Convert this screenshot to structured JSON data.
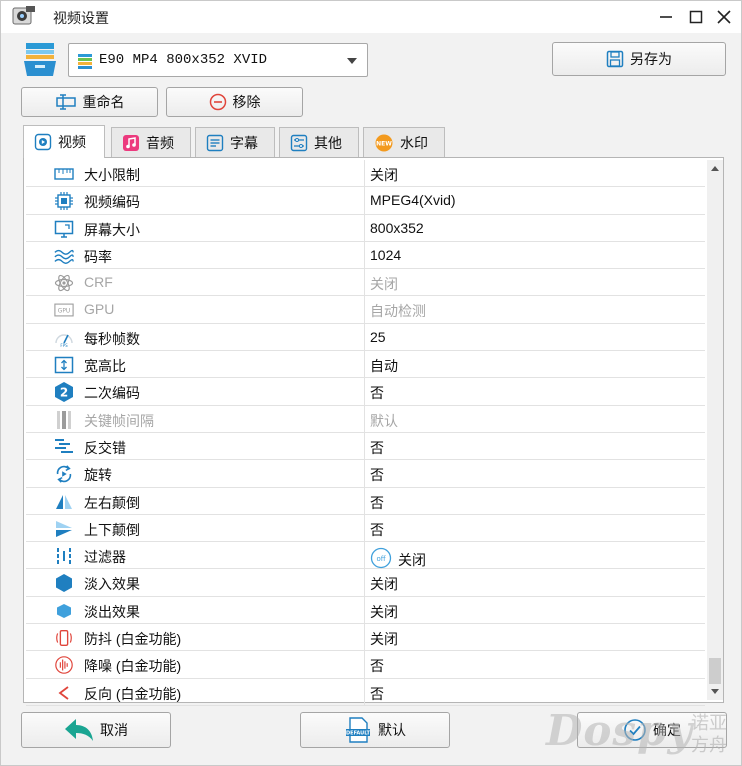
{
  "window": {
    "title": "视频设置"
  },
  "profile": {
    "selected": "E90 MP4 800x352 XVID"
  },
  "buttons": {
    "save_as": "另存为",
    "rename": "重命名",
    "remove": "移除",
    "cancel": "取消",
    "default": "默认",
    "ok": "确定"
  },
  "tabs": [
    {
      "label": "视频",
      "icon": "video-tab-icon"
    },
    {
      "label": "音频",
      "icon": "music-note-icon"
    },
    {
      "label": "字幕",
      "icon": "subtitle-icon"
    },
    {
      "label": "其他",
      "icon": "sliders-icon"
    },
    {
      "label": "水印",
      "icon": "new-badge-icon"
    }
  ],
  "properties": [
    {
      "name": "大小限制",
      "value": "关闭",
      "icon": "ruler-icon"
    },
    {
      "name": "视频编码",
      "value": "MPEG4(Xvid)",
      "icon": "chip-icon"
    },
    {
      "name": "屏幕大小",
      "value": "800x352",
      "icon": "monitor-icon"
    },
    {
      "name": "码率",
      "value": "1024",
      "icon": "wave-icon"
    },
    {
      "name": "CRF",
      "value": "关闭",
      "icon": "atom-icon",
      "disabled": true
    },
    {
      "name": "GPU",
      "value": "自动检测",
      "icon": "gpu-icon",
      "disabled": true
    },
    {
      "name": "每秒帧数",
      "value": "25",
      "icon": "fps-gauge-icon"
    },
    {
      "name": "宽高比",
      "value": "自动",
      "icon": "aspect-ratio-icon"
    },
    {
      "name": "二次编码",
      "value": "否",
      "icon": "two-pass-icon"
    },
    {
      "name": "关键帧间隔",
      "value": "默认",
      "icon": "keyframe-icon",
      "disabled": true
    },
    {
      "name": "反交错",
      "value": "否",
      "icon": "deinterlace-icon"
    },
    {
      "name": "旋转",
      "value": "否",
      "icon": "rotate-icon"
    },
    {
      "name": "左右颠倒",
      "value": "否",
      "icon": "flip-horizontal-icon"
    },
    {
      "name": "上下颠倒",
      "value": "否",
      "icon": "flip-vertical-icon"
    },
    {
      "name": "过滤器",
      "value": "关闭",
      "icon": "filter-icon",
      "badge": "off"
    },
    {
      "name": "淡入效果",
      "value": "关闭",
      "icon": "fade-in-icon"
    },
    {
      "name": "淡出效果",
      "value": "关闭",
      "icon": "fade-out-icon"
    },
    {
      "name": "防抖 (白金功能)",
      "value": "关闭",
      "icon": "stabilize-icon"
    },
    {
      "name": "降噪 (白金功能)",
      "value": "否",
      "icon": "denoise-icon"
    },
    {
      "name": "反向 (白金功能)",
      "value": "否",
      "icon": "reverse-icon"
    }
  ],
  "watermark": {
    "brand": "Dospy",
    "sub1": "诺亚",
    "sub2": "方舟"
  },
  "colors": {
    "accent": "#1e88c9",
    "disabled_text": "#a6a6a6",
    "warning_red": "#e0453b"
  }
}
